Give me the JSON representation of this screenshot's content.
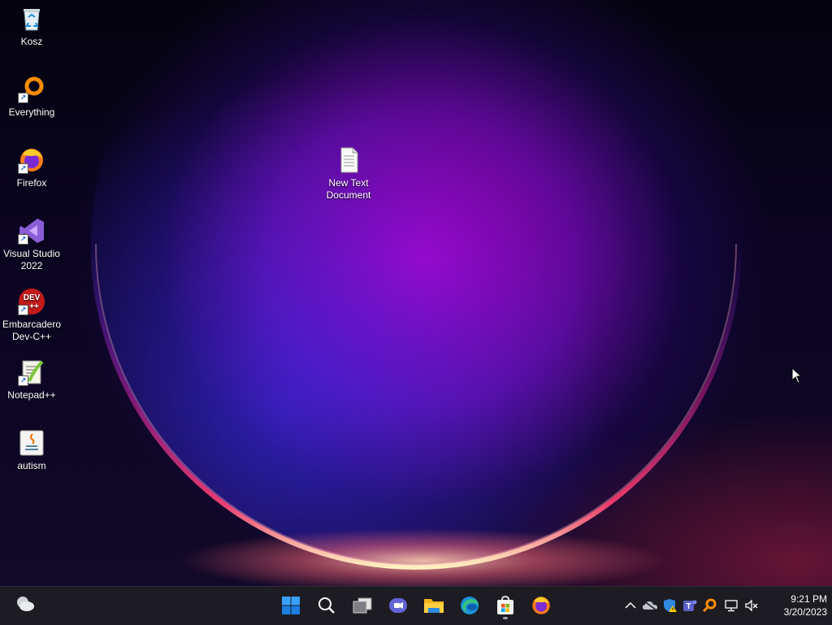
{
  "desktop": {
    "icons": [
      {
        "label": "Kosz",
        "icon": "recycle-bin-icon"
      },
      {
        "label": "Everything",
        "icon": "everything-search-icon"
      },
      {
        "label": "Firefox",
        "icon": "firefox-icon"
      },
      {
        "label": "Visual Studio 2022",
        "icon": "visual-studio-icon"
      },
      {
        "label": "Embarcadero Dev-C++",
        "icon": "devcpp-icon"
      },
      {
        "label": "Notepad++",
        "icon": "notepadpp-icon"
      },
      {
        "label": "autism",
        "icon": "java-file-icon"
      },
      {
        "label": "New Text Document",
        "icon": "text-document-icon"
      }
    ],
    "devcpp_badge": "DEV\n++"
  },
  "taskbar": {
    "widgets_icon": "weather-widget-icon",
    "apps": [
      {
        "name": "Start",
        "icon": "windows-start-icon"
      },
      {
        "name": "Search",
        "icon": "search-icon"
      },
      {
        "name": "Task View",
        "icon": "task-view-icon"
      },
      {
        "name": "Chat",
        "icon": "teams-chat-icon"
      },
      {
        "name": "File Explorer",
        "icon": "file-explorer-icon"
      },
      {
        "name": "Microsoft Edge",
        "icon": "edge-icon"
      },
      {
        "name": "Microsoft Store",
        "icon": "store-icon",
        "active": true
      },
      {
        "name": "Firefox",
        "icon": "firefox-icon"
      }
    ],
    "tray": [
      "chevron-up-icon",
      "onedrive-icon",
      "windows-security-warning-icon",
      "teams-icon",
      "everything-icon",
      "network-icon",
      "volume-muted-icon"
    ],
    "clock": {
      "time": "9:21 PM",
      "date": "3/20/2023"
    }
  },
  "colors": {
    "taskbar_bg": "#1c1c22",
    "accent_start": "#3aa0ff"
  }
}
